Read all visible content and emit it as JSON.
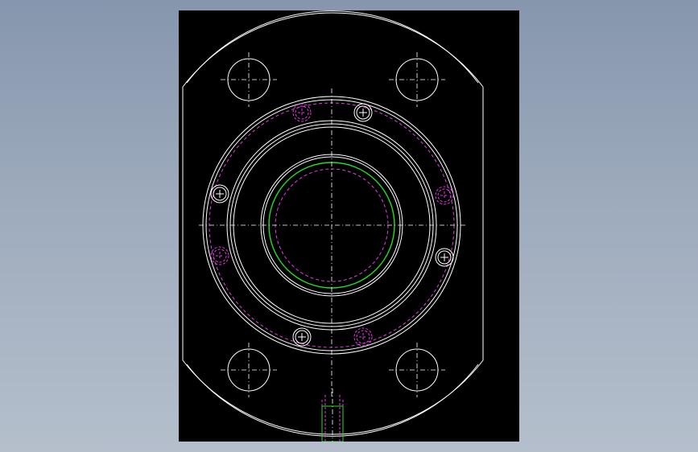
{
  "canvas": {
    "background_color": "#000000",
    "app_background_color": "#9aa7ba"
  },
  "drawing": {
    "view": "front-view",
    "line_colors": {
      "outline": "#ffffff",
      "hidden": "#e23ce2",
      "highlight": "#22dd22",
      "center_line": "#ffffff"
    },
    "features": {
      "mounting_holes": 4,
      "flange_bolts": 8,
      "bore_ring": 1,
      "bottom_port": 1
    }
  }
}
